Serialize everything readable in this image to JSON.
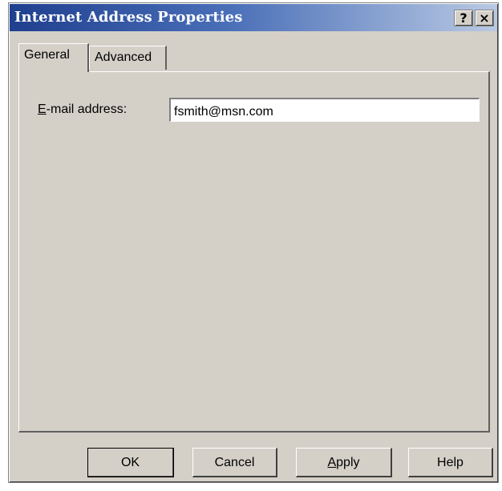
{
  "window": {
    "title": "Internet Address Properties",
    "help_glyph": "?",
    "close_glyph": "×"
  },
  "tabs": [
    {
      "label": "General",
      "active": true
    },
    {
      "label": "Advanced",
      "active": false
    }
  ],
  "general": {
    "email_label_accel": "E",
    "email_label_rest": "-mail address:",
    "email_value": "fsmith@msn.com"
  },
  "buttons": {
    "ok": "OK",
    "cancel": "Cancel",
    "apply_accel": "A",
    "apply_rest": "pply",
    "help": "Help"
  },
  "colors": {
    "dialog_face": "#d4d0c8",
    "title_gradient_start": "#1f3f8f",
    "title_gradient_end": "#b9c9e3",
    "title_text": "#ffffff"
  }
}
